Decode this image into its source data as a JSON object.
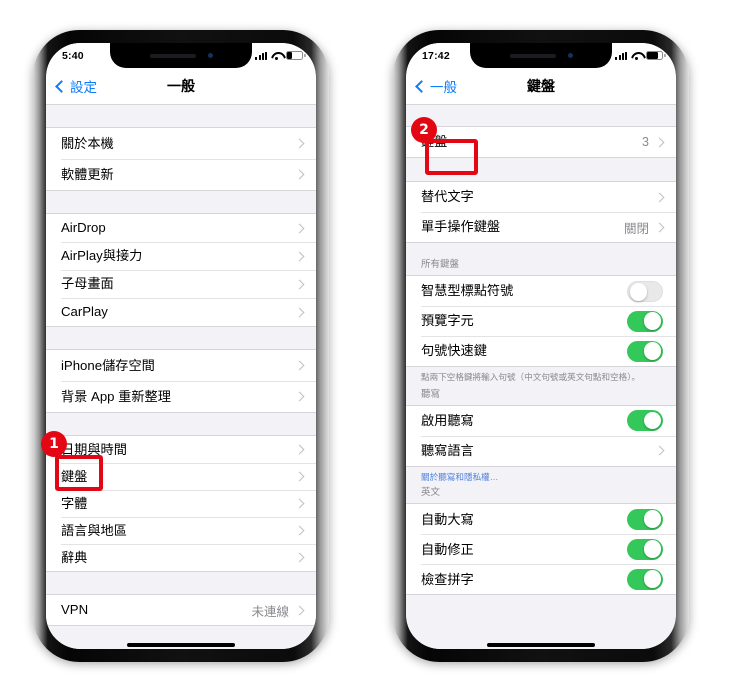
{
  "page": {
    "title": "iOS Settings - General and Keyboard screens",
    "accent_blue": "#0a7cff",
    "accent_green": "#34c759",
    "annotation_red": "#e30613"
  },
  "phones": [
    {
      "id": "left",
      "status": {
        "time": "5:40",
        "signal": "signal-bars-icon",
        "wifi": "wifi-icon",
        "battery": "battery-low-icon"
      },
      "nav": {
        "back_label": "設定",
        "title": "一般"
      },
      "sections": [
        {
          "rows": [
            {
              "label": "關於本機",
              "accessory": "chevron"
            },
            {
              "label": "軟體更新",
              "accessory": "chevron"
            }
          ]
        },
        {
          "rows": [
            {
              "label": "AirDrop",
              "accessory": "chevron"
            },
            {
              "label": "AirPlay與接力",
              "accessory": "chevron"
            },
            {
              "label": "子母畫面",
              "accessory": "chevron"
            },
            {
              "label": "CarPlay",
              "accessory": "chevron"
            }
          ]
        },
        {
          "rows": [
            {
              "label": "iPhone儲存空間",
              "accessory": "chevron"
            },
            {
              "label": "背景 App 重新整理",
              "accessory": "chevron"
            }
          ]
        },
        {
          "rows": [
            {
              "label": "日期與時間",
              "accessory": "chevron"
            },
            {
              "label": "鍵盤",
              "accessory": "chevron",
              "highlighted": true
            },
            {
              "label": "字體",
              "accessory": "chevron"
            },
            {
              "label": "語言與地區",
              "accessory": "chevron"
            },
            {
              "label": "辭典",
              "accessory": "chevron"
            }
          ]
        },
        {
          "rows": [
            {
              "label": "VPN",
              "value": "未連線",
              "accessory": "chevron"
            }
          ]
        }
      ],
      "badge": "1"
    },
    {
      "id": "right",
      "status": {
        "time": "17:42",
        "signal": "signal-bars-icon",
        "wifi": "wifi-icon",
        "battery": "battery-icon"
      },
      "nav": {
        "back_label": "一般",
        "title": "鍵盤"
      },
      "sections": [
        {
          "rows": [
            {
              "label": "鍵盤",
              "value": "3",
              "accessory": "chevron",
              "highlighted": true
            }
          ]
        },
        {
          "rows": [
            {
              "label": "替代文字",
              "accessory": "chevron"
            },
            {
              "label": "單手操作鍵盤",
              "value": "關閉",
              "accessory": "chevron"
            }
          ]
        },
        {
          "header": "所有鍵盤",
          "rows": [
            {
              "label": "智慧型標點符號",
              "accessory": "toggle",
              "toggle": "off"
            },
            {
              "label": "預覽字元",
              "accessory": "toggle",
              "toggle": "on"
            },
            {
              "label": "句號快速鍵",
              "accessory": "toggle",
              "toggle": "on"
            }
          ],
          "footer": "點兩下空格鍵將輸入句號（中文句號或英文句點和空格）。"
        },
        {
          "header": "聽寫",
          "rows": [
            {
              "label": "啟用聽寫",
              "accessory": "toggle",
              "toggle": "on"
            },
            {
              "label": "聽寫語言",
              "accessory": "chevron"
            }
          ],
          "footer_link": "關於聽寫和隱私權…"
        },
        {
          "header": "英文",
          "rows": [
            {
              "label": "自動大寫",
              "accessory": "toggle",
              "toggle": "on"
            },
            {
              "label": "自動修正",
              "accessory": "toggle",
              "toggle": "on"
            },
            {
              "label": "檢查拼字",
              "accessory": "toggle",
              "toggle": "on"
            }
          ]
        }
      ],
      "badge": "2"
    }
  ]
}
